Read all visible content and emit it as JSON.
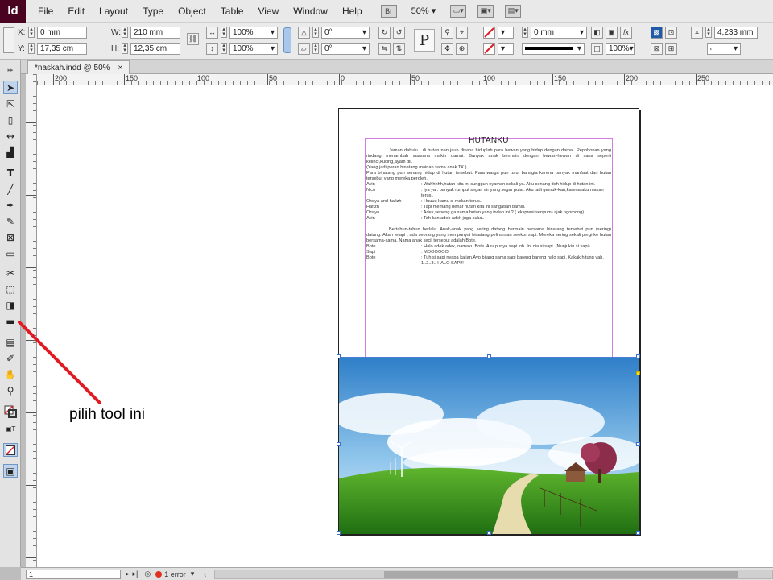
{
  "app": {
    "logo": "Id"
  },
  "menu": [
    "File",
    "Edit",
    "Layout",
    "Type",
    "Object",
    "Table",
    "View",
    "Window",
    "Help"
  ],
  "menubar_tools": {
    "zoom": "50%"
  },
  "control": {
    "x_label": "X:",
    "x_value": "0 mm",
    "y_label": "Y:",
    "y_value": "17,35 cm",
    "w_label": "W:",
    "w_value": "210 mm",
    "h_label": "H:",
    "h_value": "12,35 cm",
    "scale_x": "100%",
    "scale_y": "100%",
    "angle": "0°",
    "shear": "0°",
    "stroke_weight": "0 mm",
    "opacity": "100%",
    "gap": "4,233 mm"
  },
  "tab": {
    "title": "*naskah.indd @ 50%",
    "close": "×"
  },
  "ruler": {
    "h_labels": [
      "200",
      "150",
      "100",
      "50",
      "0",
      "50",
      "100",
      "150",
      "200",
      "250"
    ]
  },
  "document": {
    "title": "HUTANKU",
    "paragraphs": [
      "Jaman dahulu , di hutan nan jauh disana hiduplah para hewan yang hidup dengan damai. Pepohonan yang rindang menambah suasana makin damai. Banyak anak bermain dengan hewan-hewan di sana seperti kelinci,kucing,ayam dll.",
      "(Yang jadi peran binatang mainan sama anak TK.)",
      "Para binatang pun senang hidup di hutan tersebut. Para warga pun turut bahagia karena banyak manfaat dari hutan tersebut yang mereka peroleh."
    ],
    "dialog1": [
      {
        "who": "Avin",
        "txt": ": Wahhhhh,hutan kita ini sungguh nyaman sekali ya. Aku senang deh hidup di hutan ini."
      },
      {
        "who": "Nico",
        "txt": ": Iya ya.. banyak rumput segar, air yang segar pula . Aku jadi gemuk-kan,karena aku makan terus.."
      },
      {
        "who": "Orsiya  and hafizh",
        "txt": ": Huuuu kamu si makan terus.."
      },
      {
        "who": "Hafizh",
        "txt": ": Tapi memang benar hutan kita ini sangatlah damai."
      },
      {
        "who": "Orsiya",
        "txt": ": Adek,seneng ga sama hutan yang indah ini ? ( ekspresi senyum) ajak ngomong)"
      },
      {
        "who": "Avin",
        "txt": ": Tah kan,adek adek juga suka.."
      }
    ],
    "paragraph2": "Bertahun-tahun berlalu. Anak-anak yang sering datang bermain bersama binatang tersebut pun (sering) datang. Akan tetapi , ada seorang yang mempunyai binatang peliharaan seekor sapi. Mereka sering sekali pergi ke hutan bersama-sama. Nama anak kecil tersebut adalah Bote.",
    "dialog2": [
      {
        "who": "Bote",
        "txt": ": Halo adek adek, namaku Bote. Aku punya sapi loh. Ini dia si sapi. (Nunjukin si sapi)"
      },
      {
        "who": "Sapi",
        "txt": ": MOOOOOO"
      },
      {
        "who": "Bote",
        "txt": ": Tuh,si sapi nyapa kalian.Ayo bilang sama sapi bareng bareng halo sapi. Kakak hitung yah. 1..2..3.. HALO SAPI!!"
      }
    ]
  },
  "annotation": {
    "text": "pilih tool ini"
  },
  "status": {
    "page": "1",
    "errors": "1 error"
  },
  "colors": {
    "accent_arrow": "#e01b24",
    "margin_guide": "#d27be3",
    "selection": "#3a6fd0"
  }
}
